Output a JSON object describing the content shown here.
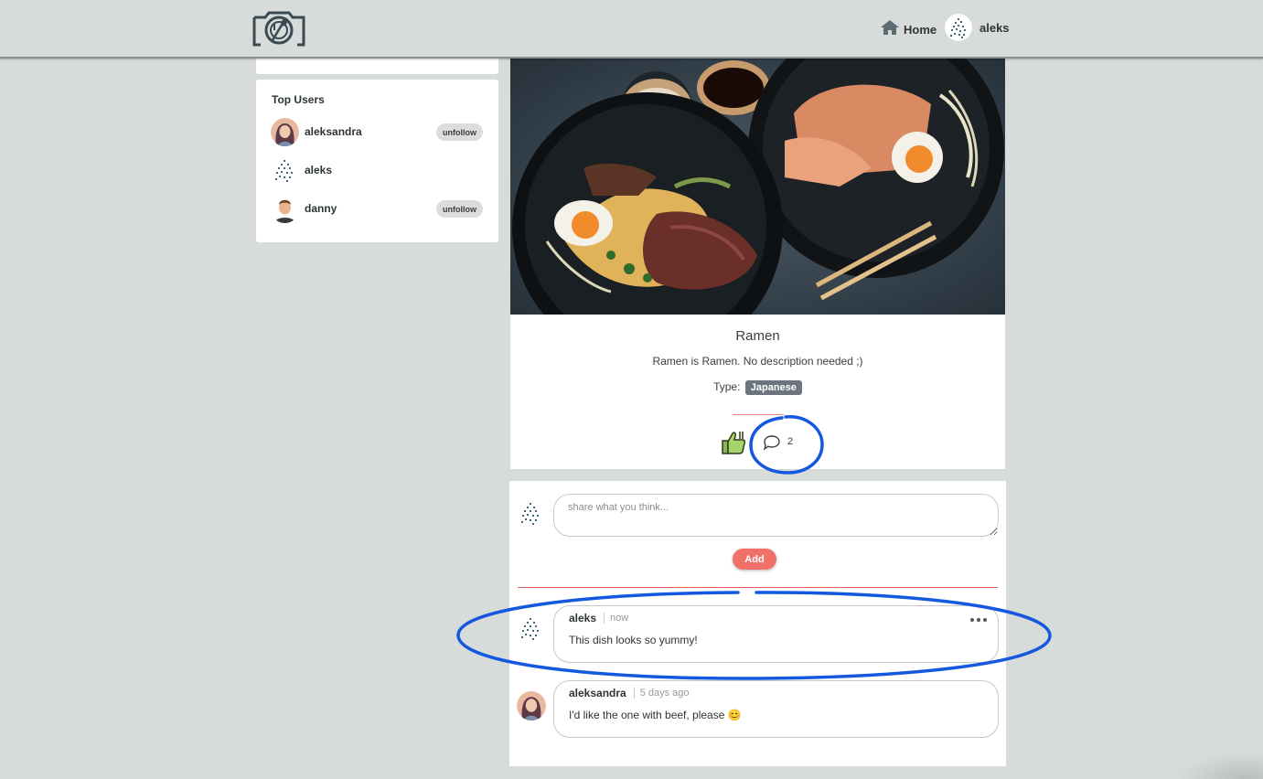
{
  "navbar": {
    "home_label": "Home",
    "user_label": "aleks",
    "logo_icon": "camera-food-logo-icon",
    "home_icon": "home-icon"
  },
  "top_users": {
    "title": "Top Users",
    "users": [
      {
        "name": "aleksandra",
        "button": "unfollow",
        "avatar": "woman-avatar"
      },
      {
        "name": "aleks",
        "button": "",
        "avatar": "scatter-avatar"
      },
      {
        "name": "danny",
        "button": "unfollow",
        "avatar": "man-avatar"
      }
    ]
  },
  "dish": {
    "title": "Ramen",
    "description": "Ramen is Ramen. No description needed ;)",
    "type_label": "Type:",
    "type_value": "Japanese",
    "like_icon": "thumbs-up-icon",
    "comment_icon": "speech-bubble-icon",
    "comment_count": "2"
  },
  "comment_form": {
    "placeholder": "share what you think...",
    "add_label": "Add"
  },
  "comments": [
    {
      "author": "aleks",
      "time": "now",
      "text": "This dish looks so yummy!",
      "avatar": "scatter-avatar",
      "has_menu": true
    },
    {
      "author": "aleksandra",
      "time": "5 days ago",
      "text": "I'd like the one with beef, please 😊",
      "avatar": "woman-avatar",
      "has_menu": false
    }
  ],
  "colors": {
    "background": "#d7dcda",
    "accent": "#f2706a",
    "badge": "#6c757d",
    "annotation": "#1458e0"
  }
}
